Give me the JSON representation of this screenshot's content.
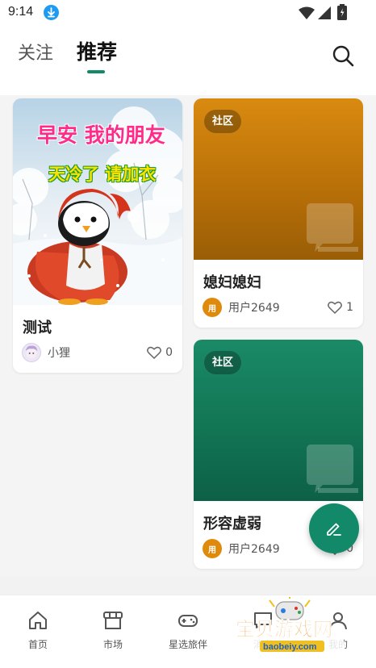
{
  "status_bar": {
    "time": "9:14",
    "icons": [
      "download-icon",
      "wifi-icon",
      "signal-icon",
      "battery-icon"
    ]
  },
  "header": {
    "tabs": [
      {
        "label": "关注",
        "active": false
      },
      {
        "label": "推荐",
        "active": true
      }
    ],
    "search_icon": "search-icon"
  },
  "feed": {
    "cards": [
      {
        "image_lines": [
          "早安 我的朋友",
          "天冷了 请加衣"
        ],
        "title": "测试",
        "author": "小狸",
        "likes": "0"
      },
      {
        "tag": "社区",
        "title": "媳妇媳妇",
        "author_initial": "用",
        "author": "用户2649",
        "likes": "1"
      },
      {
        "tag": "社区",
        "title": "形容虚弱",
        "author_initial": "用",
        "author": "用户2649",
        "likes": "0"
      }
    ]
  },
  "fab": {
    "icon": "edit-icon"
  },
  "bottom_nav": {
    "items": [
      {
        "label": "首页",
        "icon": "home-icon"
      },
      {
        "label": "市场",
        "icon": "shop-icon"
      },
      {
        "label": "星选旅伴",
        "icon": "gamepad-icon"
      },
      {
        "label": "消息",
        "icon": "message-icon"
      },
      {
        "label": "我的",
        "icon": "user-icon"
      }
    ]
  },
  "watermark": {
    "name": "宝贝游戏网",
    "url": "baobeiy.com"
  },
  "colors": {
    "accent": "#128a6a",
    "card_orange": "#c07a0a",
    "card_green": "#137a58",
    "avatar": "#e08a0c",
    "download_blue": "#1e9bf0"
  }
}
